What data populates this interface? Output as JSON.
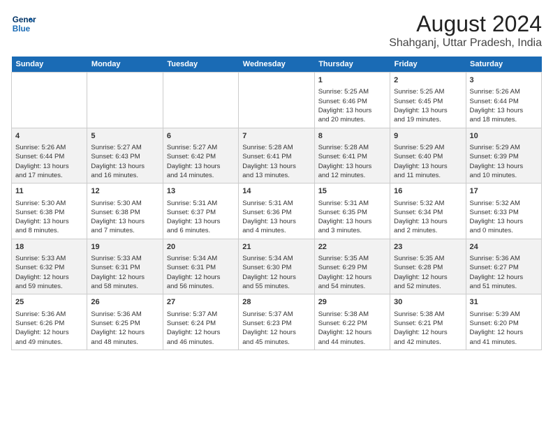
{
  "header": {
    "logo_line1": "General",
    "logo_line2": "Blue",
    "title": "August 2024",
    "subtitle": "Shahganj, Uttar Pradesh, India"
  },
  "weekdays": [
    "Sunday",
    "Monday",
    "Tuesday",
    "Wednesday",
    "Thursday",
    "Friday",
    "Saturday"
  ],
  "weeks": [
    [
      {
        "day": "",
        "info": ""
      },
      {
        "day": "",
        "info": ""
      },
      {
        "day": "",
        "info": ""
      },
      {
        "day": "",
        "info": ""
      },
      {
        "day": "1",
        "info": "Sunrise: 5:25 AM\nSunset: 6:46 PM\nDaylight: 13 hours\nand 20 minutes."
      },
      {
        "day": "2",
        "info": "Sunrise: 5:25 AM\nSunset: 6:45 PM\nDaylight: 13 hours\nand 19 minutes."
      },
      {
        "day": "3",
        "info": "Sunrise: 5:26 AM\nSunset: 6:44 PM\nDaylight: 13 hours\nand 18 minutes."
      }
    ],
    [
      {
        "day": "4",
        "info": "Sunrise: 5:26 AM\nSunset: 6:44 PM\nDaylight: 13 hours\nand 17 minutes."
      },
      {
        "day": "5",
        "info": "Sunrise: 5:27 AM\nSunset: 6:43 PM\nDaylight: 13 hours\nand 16 minutes."
      },
      {
        "day": "6",
        "info": "Sunrise: 5:27 AM\nSunset: 6:42 PM\nDaylight: 13 hours\nand 14 minutes."
      },
      {
        "day": "7",
        "info": "Sunrise: 5:28 AM\nSunset: 6:41 PM\nDaylight: 13 hours\nand 13 minutes."
      },
      {
        "day": "8",
        "info": "Sunrise: 5:28 AM\nSunset: 6:41 PM\nDaylight: 13 hours\nand 12 minutes."
      },
      {
        "day": "9",
        "info": "Sunrise: 5:29 AM\nSunset: 6:40 PM\nDaylight: 13 hours\nand 11 minutes."
      },
      {
        "day": "10",
        "info": "Sunrise: 5:29 AM\nSunset: 6:39 PM\nDaylight: 13 hours\nand 10 minutes."
      }
    ],
    [
      {
        "day": "11",
        "info": "Sunrise: 5:30 AM\nSunset: 6:38 PM\nDaylight: 13 hours\nand 8 minutes."
      },
      {
        "day": "12",
        "info": "Sunrise: 5:30 AM\nSunset: 6:38 PM\nDaylight: 13 hours\nand 7 minutes."
      },
      {
        "day": "13",
        "info": "Sunrise: 5:31 AM\nSunset: 6:37 PM\nDaylight: 13 hours\nand 6 minutes."
      },
      {
        "day": "14",
        "info": "Sunrise: 5:31 AM\nSunset: 6:36 PM\nDaylight: 13 hours\nand 4 minutes."
      },
      {
        "day": "15",
        "info": "Sunrise: 5:31 AM\nSunset: 6:35 PM\nDaylight: 13 hours\nand 3 minutes."
      },
      {
        "day": "16",
        "info": "Sunrise: 5:32 AM\nSunset: 6:34 PM\nDaylight: 13 hours\nand 2 minutes."
      },
      {
        "day": "17",
        "info": "Sunrise: 5:32 AM\nSunset: 6:33 PM\nDaylight: 13 hours\nand 0 minutes."
      }
    ],
    [
      {
        "day": "18",
        "info": "Sunrise: 5:33 AM\nSunset: 6:32 PM\nDaylight: 12 hours\nand 59 minutes."
      },
      {
        "day": "19",
        "info": "Sunrise: 5:33 AM\nSunset: 6:31 PM\nDaylight: 12 hours\nand 58 minutes."
      },
      {
        "day": "20",
        "info": "Sunrise: 5:34 AM\nSunset: 6:31 PM\nDaylight: 12 hours\nand 56 minutes."
      },
      {
        "day": "21",
        "info": "Sunrise: 5:34 AM\nSunset: 6:30 PM\nDaylight: 12 hours\nand 55 minutes."
      },
      {
        "day": "22",
        "info": "Sunrise: 5:35 AM\nSunset: 6:29 PM\nDaylight: 12 hours\nand 54 minutes."
      },
      {
        "day": "23",
        "info": "Sunrise: 5:35 AM\nSunset: 6:28 PM\nDaylight: 12 hours\nand 52 minutes."
      },
      {
        "day": "24",
        "info": "Sunrise: 5:36 AM\nSunset: 6:27 PM\nDaylight: 12 hours\nand 51 minutes."
      }
    ],
    [
      {
        "day": "25",
        "info": "Sunrise: 5:36 AM\nSunset: 6:26 PM\nDaylight: 12 hours\nand 49 minutes."
      },
      {
        "day": "26",
        "info": "Sunrise: 5:36 AM\nSunset: 6:25 PM\nDaylight: 12 hours\nand 48 minutes."
      },
      {
        "day": "27",
        "info": "Sunrise: 5:37 AM\nSunset: 6:24 PM\nDaylight: 12 hours\nand 46 minutes."
      },
      {
        "day": "28",
        "info": "Sunrise: 5:37 AM\nSunset: 6:23 PM\nDaylight: 12 hours\nand 45 minutes."
      },
      {
        "day": "29",
        "info": "Sunrise: 5:38 AM\nSunset: 6:22 PM\nDaylight: 12 hours\nand 44 minutes."
      },
      {
        "day": "30",
        "info": "Sunrise: 5:38 AM\nSunset: 6:21 PM\nDaylight: 12 hours\nand 42 minutes."
      },
      {
        "day": "31",
        "info": "Sunrise: 5:39 AM\nSunset: 6:20 PM\nDaylight: 12 hours\nand 41 minutes."
      }
    ]
  ]
}
